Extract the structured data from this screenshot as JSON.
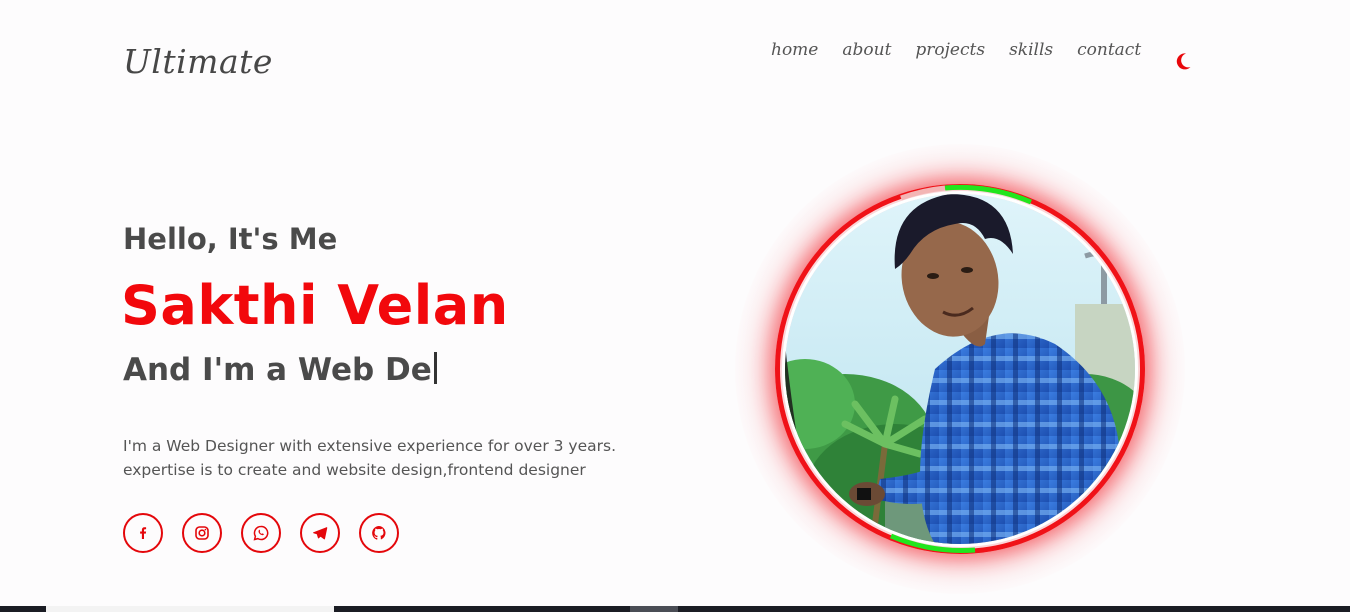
{
  "header": {
    "logo": "Ultimate",
    "nav": [
      "home",
      "about",
      "projects",
      "skills",
      "contact"
    ],
    "theme_icon": "moon-icon"
  },
  "hero": {
    "greeting": "Hello, It's Me",
    "name": "Sakthi Velan",
    "role": "And I'm a Web De",
    "description_line1": "I'm a Web Designer with extensive experience for over 3 years.",
    "description_line2": "expertise is to create and website design,frontend designer"
  },
  "socials": [
    {
      "icon": "facebook-icon"
    },
    {
      "icon": "instagram-icon"
    },
    {
      "icon": "whatsapp-icon"
    },
    {
      "icon": "telegram-icon"
    },
    {
      "icon": "github-icon"
    }
  ],
  "colors": {
    "accent": "#f2080c",
    "text": "#4a4a4a",
    "ring_green": "#22e51e"
  }
}
